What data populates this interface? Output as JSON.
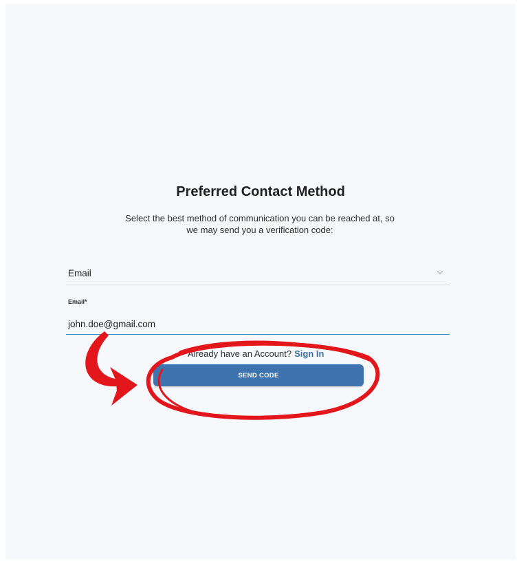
{
  "header": {
    "title": "Preferred Contact Method",
    "subtitle": "Select the best method of communication you can be reached at, so we may send you a verification code:"
  },
  "contact_method": {
    "selected": "Email",
    "icon": "chevron-down-icon"
  },
  "email_field": {
    "label": "Email*",
    "value": "john.doe@gmail.com"
  },
  "account": {
    "prompt": "Already have an Account?",
    "link_label": "Sign In"
  },
  "actions": {
    "send_label": "SEND CODE"
  },
  "colors": {
    "primary_button": "#3d74b0",
    "link": "#3a6fa8",
    "annotation": "#e3161b",
    "background": "#f7f8fb"
  }
}
